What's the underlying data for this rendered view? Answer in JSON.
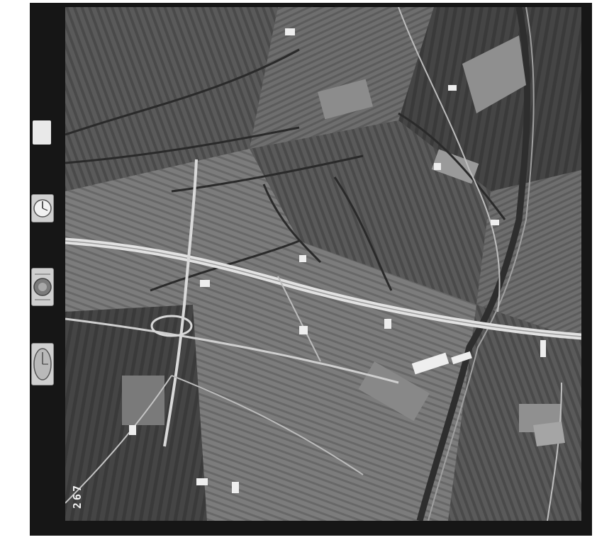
{
  "film": {
    "frame_number": "267",
    "bottom_code": "",
    "note_card_text": ""
  },
  "colors": {
    "frame": "#161616",
    "field_dark": "#3f3f3f",
    "field_mid": "#6b6b6b",
    "field_light": "#8e8e8e",
    "road": "#d7d7d7"
  },
  "instruments": [
    {
      "name": "altimeter-dial-icon"
    },
    {
      "name": "level-bubble-icon"
    },
    {
      "name": "clock-dial-icon"
    }
  ]
}
